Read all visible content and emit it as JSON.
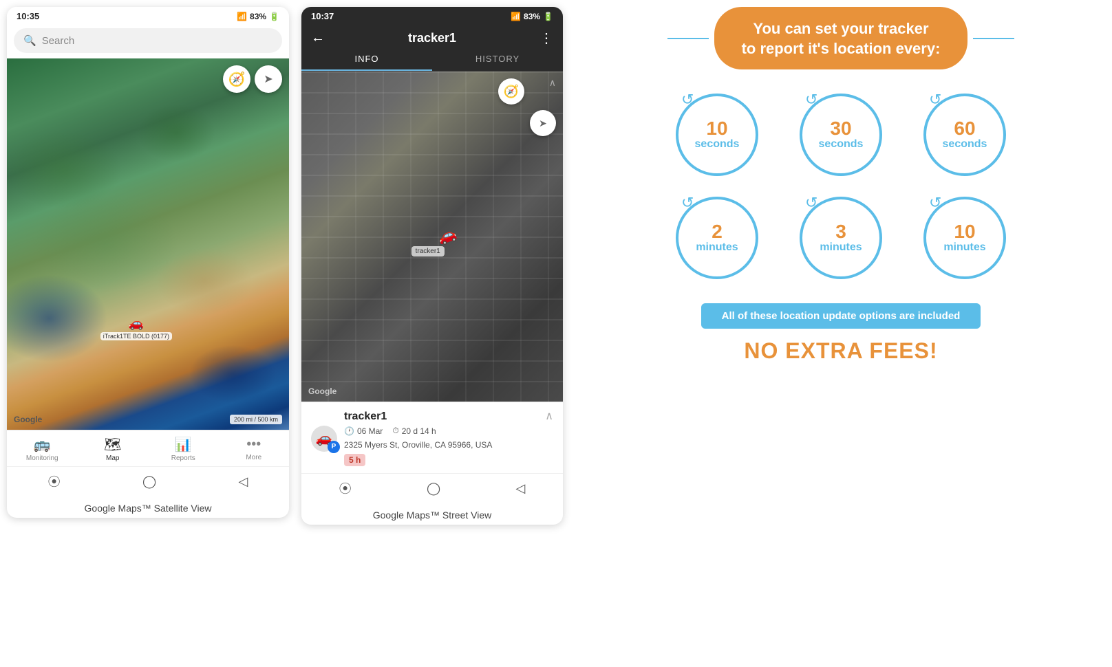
{
  "phones": {
    "left": {
      "status_time": "10:35",
      "status_signal": "▲▲▲",
      "status_battery": "83%",
      "search_placeholder": "Search",
      "tracker_label": "iTrack1TE BOLD (0177)",
      "google_logo": "Google",
      "scale_label": "200 mi / 500 km",
      "compass_icon": "🧭",
      "nav_icon": "➤",
      "nav_items": [
        {
          "icon": "🚌",
          "label": "Monitoring",
          "active": false
        },
        {
          "icon": "🗺",
          "label": "Map",
          "active": true
        },
        {
          "icon": "📊",
          "label": "Reports",
          "active": false
        },
        {
          "icon": "•••",
          "label": "More",
          "active": false
        }
      ],
      "caption": "Google Maps™ Satellite View"
    },
    "right": {
      "status_time": "10:37",
      "status_signal": "▲▲▲",
      "status_battery": "83%",
      "header_title": "tracker1",
      "back_icon": "←",
      "more_icon": "⋮",
      "tabs": [
        {
          "label": "INFO",
          "active": true
        },
        {
          "label": "HISTORY",
          "active": false
        }
      ],
      "tracker_name": "tracker1",
      "tracker_p": "P",
      "aerial_label": "tracker1",
      "google_logo": "Google",
      "date": "06 Mar",
      "duration": "20 d 14 h",
      "address": "2325 Myers St, Oroville, CA 95966, USA",
      "time_badge": "5 h",
      "caption": "Google Maps™ Street View"
    }
  },
  "info_panel": {
    "title_line1": "You can set your tracker",
    "title_line2": "to report it's location every:",
    "circles": [
      {
        "number": "10",
        "unit": "seconds"
      },
      {
        "number": "30",
        "unit": "seconds"
      },
      {
        "number": "60",
        "unit": "seconds"
      },
      {
        "number": "2",
        "unit": "minutes"
      },
      {
        "number": "3",
        "unit": "minutes"
      },
      {
        "number": "10",
        "unit": "minutes"
      }
    ],
    "included_text": "All of these location update options are included",
    "no_fees_text": "NO EXTRA FEES!"
  }
}
